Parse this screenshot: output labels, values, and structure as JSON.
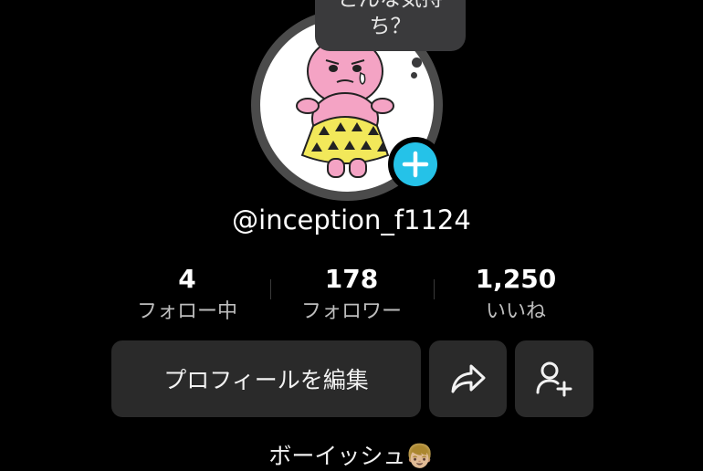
{
  "profile": {
    "mood_prompt": "どんな気持\nち？",
    "username": "@inception_f1124",
    "bio": "ボーイッシュ👦🏼"
  },
  "stats": [
    {
      "value": "4",
      "label": "フォロー中"
    },
    {
      "value": "178",
      "label": "フォロワー"
    },
    {
      "value": "1,250",
      "label": "いいね"
    }
  ],
  "buttons": {
    "edit_profile": "プロフィールを編集",
    "share_icon": "share-arrow-icon",
    "add_friend_icon": "person-add-icon"
  },
  "colors": {
    "background": "#000000",
    "accent": "#25c2e8",
    "button_bg": "#2a2a2a"
  }
}
